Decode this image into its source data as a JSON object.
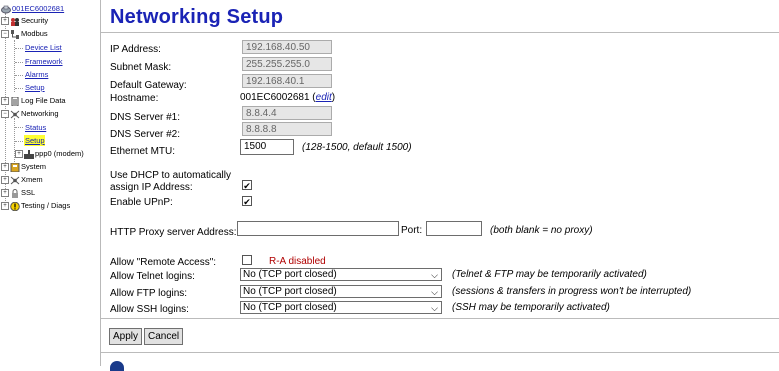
{
  "sidebar": {
    "root": "001EC6002681",
    "items": [
      {
        "label": "Security"
      },
      {
        "label": "Modbus"
      },
      {
        "label": "Device List"
      },
      {
        "label": "Framework"
      },
      {
        "label": "Alarms"
      },
      {
        "label": "Setup"
      },
      {
        "label": "Log File Data"
      },
      {
        "label": "Networking"
      },
      {
        "label": "Status"
      },
      {
        "label": "Setup"
      },
      {
        "label": "ppp0 (modem)"
      },
      {
        "label": "System"
      },
      {
        "label": "Xmem"
      },
      {
        "label": "SSL"
      },
      {
        "label": "Testing / Diags"
      }
    ],
    "selected_color": "#ffff33",
    "link_color": "#1a23b5"
  },
  "main": {
    "title": "Networking Setup",
    "ip_address": {
      "label": "IP Address:",
      "value": "192.168.40.50"
    },
    "subnet_mask": {
      "label": "Subnet Mask:",
      "value": "255.255.255.0"
    },
    "default_gateway": {
      "label": "Default Gateway:",
      "value": "192.168.40.1"
    },
    "hostname": {
      "label": "Hostname:",
      "value": "001EC6002681",
      "open_paren": "(",
      "edit_link": "edit",
      "close_paren": ")"
    },
    "dns1": {
      "label": "DNS Server #1:",
      "value": "8.8.4.4"
    },
    "dns2": {
      "label": "DNS Server #2:",
      "value": "8.8.8.8"
    },
    "mtu": {
      "label": "Ethernet MTU:",
      "value": "1500",
      "hint": "(128-1500, default 1500)"
    },
    "dhcp": {
      "label_line1": "Use DHCP to automatically",
      "label_line2": "assign IP Address:",
      "checked": "✔"
    },
    "upnp": {
      "label": "Enable UPnP:",
      "checked": "✔"
    },
    "proxy": {
      "label": "HTTP Proxy server Address:",
      "address": "",
      "port_label": "Port:",
      "port": "",
      "hint": "(both blank = no proxy)"
    },
    "remote_access": {
      "label": "Allow \"Remote Access\":",
      "status": "R-A disabled",
      "status_color": "#b00000"
    },
    "telnet": {
      "label": "Allow Telnet logins:",
      "value": "No (TCP port closed)",
      "hint": "(Telnet & FTP may be temporarily activated)"
    },
    "ftp": {
      "label": "Allow FTP logins:",
      "value": "No (TCP port closed)",
      "hint": "(sessions & transfers in progress won't be interrupted)"
    },
    "ssh": {
      "label": "Allow SSH logins:",
      "value": "No (TCP port closed)",
      "hint": "(SSH may be temporarily activated)"
    },
    "buttons": {
      "apply": "Apply",
      "cancel": "Cancel"
    },
    "title_color": "#1a23b5"
  }
}
